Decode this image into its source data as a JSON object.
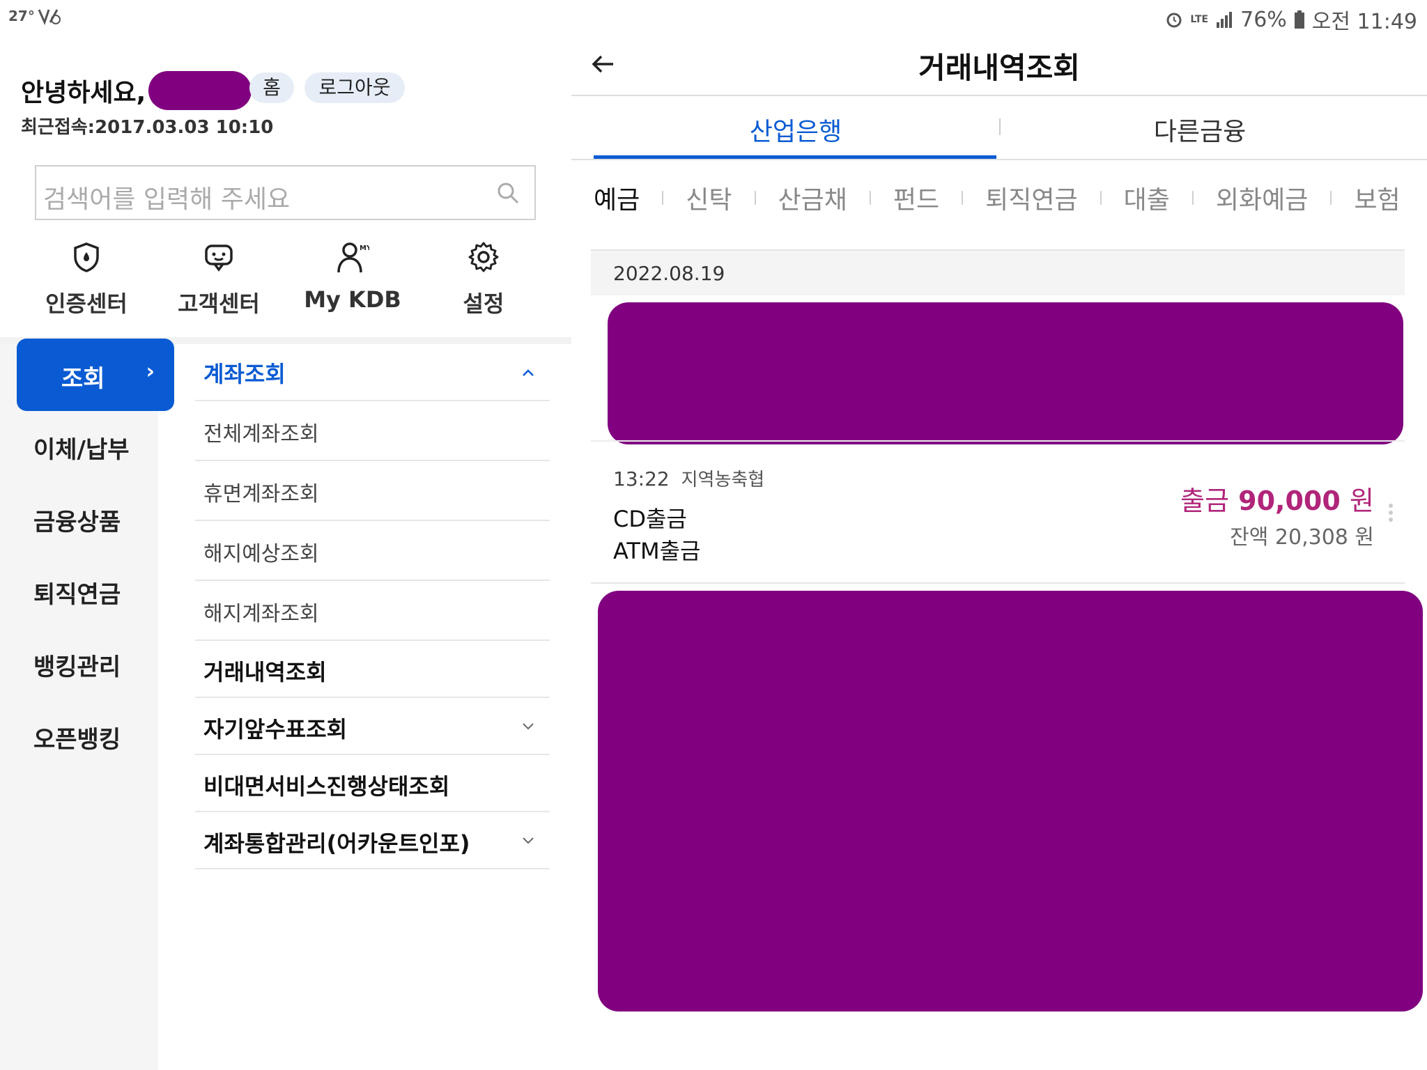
{
  "status_bar": {
    "temperature": "27°",
    "battery": "76%",
    "time": "오전 11:49",
    "network": "LTE"
  },
  "left": {
    "greeting": "안녕하세요,",
    "home_chip": "홈",
    "logout_chip": "로그아웃",
    "last_login": "최근접속:2017.03.03 10:10",
    "search_placeholder": "검색어를 입력해 주세요",
    "quick_menu": [
      {
        "label": "인증센터",
        "icon": "shield-icon"
      },
      {
        "label": "고객센터",
        "icon": "chat-icon"
      },
      {
        "label": "My KDB",
        "icon": "person-icon"
      },
      {
        "label": "설정",
        "icon": "gear-icon"
      }
    ],
    "categories": [
      "조회",
      "이체/납부",
      "금융상품",
      "퇴직연금",
      "뱅킹관리",
      "오픈뱅킹"
    ],
    "active_category": "조회",
    "menu": [
      {
        "label": "계좌조회"
      },
      {
        "label": "전체계좌조회"
      },
      {
        "label": "휴면계좌조회"
      },
      {
        "label": "해지예상조회"
      },
      {
        "label": "해지계좌조회"
      },
      {
        "label": "거래내역조회"
      },
      {
        "label": "자기앞수표조회"
      },
      {
        "label": "비대면서비스진행상태조회"
      },
      {
        "label": "계좌통합관리(어카운트인포)"
      }
    ]
  },
  "right": {
    "title": "거래내역조회",
    "tabs": [
      "산업은행",
      "다른금융"
    ],
    "active_tab": "산업은행",
    "subtabs": [
      "예금",
      "신탁",
      "산금채",
      "펀드",
      "퇴직연금",
      "대출",
      "외화예금",
      "보험"
    ],
    "active_subtab": "예금",
    "date": "2022.08.19",
    "transaction": {
      "time": "13:22",
      "place": "지역농축협",
      "desc1": "CD출금",
      "desc2": "ATM출금",
      "amount_label": "출금",
      "amount": "90,000",
      "currency": "원",
      "balance": "잔액 20,308 원"
    }
  },
  "colors": {
    "accent": "#0a5bd3",
    "withdraw": "#b0257a",
    "redaction": "#800080"
  }
}
